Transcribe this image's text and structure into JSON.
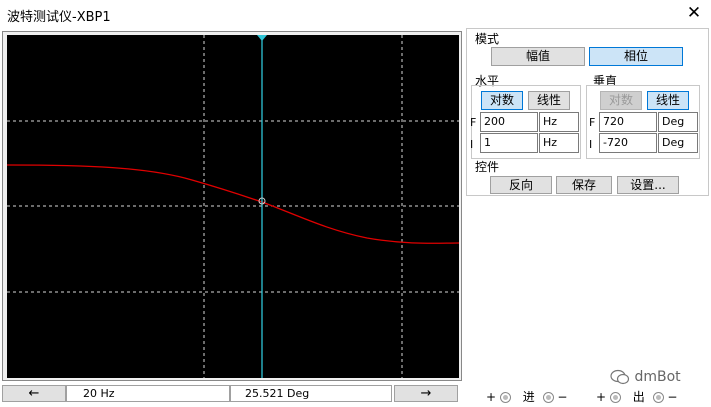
{
  "window": {
    "title": "波特测试仪-XBP1",
    "close_glyph": "✕"
  },
  "mode": {
    "label": "模式",
    "magnitude": "幅值",
    "phase": "相位",
    "selected": "相位"
  },
  "horizontal": {
    "label": "水平",
    "log": "对数",
    "linear": "线性",
    "selected": "对数",
    "f_label": "F",
    "f_value": "200",
    "f_unit": "Hz",
    "i_label": "I",
    "i_value": "1",
    "i_unit": "Hz"
  },
  "vertical": {
    "label": "垂直",
    "log": "对数",
    "linear": "线性",
    "selected": "线性",
    "f_label": "F",
    "f_value": "720",
    "f_unit": "Deg",
    "i_label": "I",
    "i_value": "-720",
    "i_unit": "Deg"
  },
  "controls": {
    "label": "控件",
    "reverse": "反向",
    "save": "保存",
    "settings": "设置..."
  },
  "readout": {
    "left_arrow": "←",
    "right_arrow": "→",
    "frequency": "20  Hz",
    "phase": "25.521 Deg"
  },
  "terminals": {
    "in_plus": "+",
    "in_label": "进",
    "in_minus": "−",
    "out_plus": "+",
    "out_label": "出",
    "out_minus": "−"
  },
  "watermark": "dmBot",
  "colors": {
    "trace": "#e00000",
    "cursor": "#2ec4d6",
    "grid": "#d8d8d8",
    "screen": "#000000"
  }
}
